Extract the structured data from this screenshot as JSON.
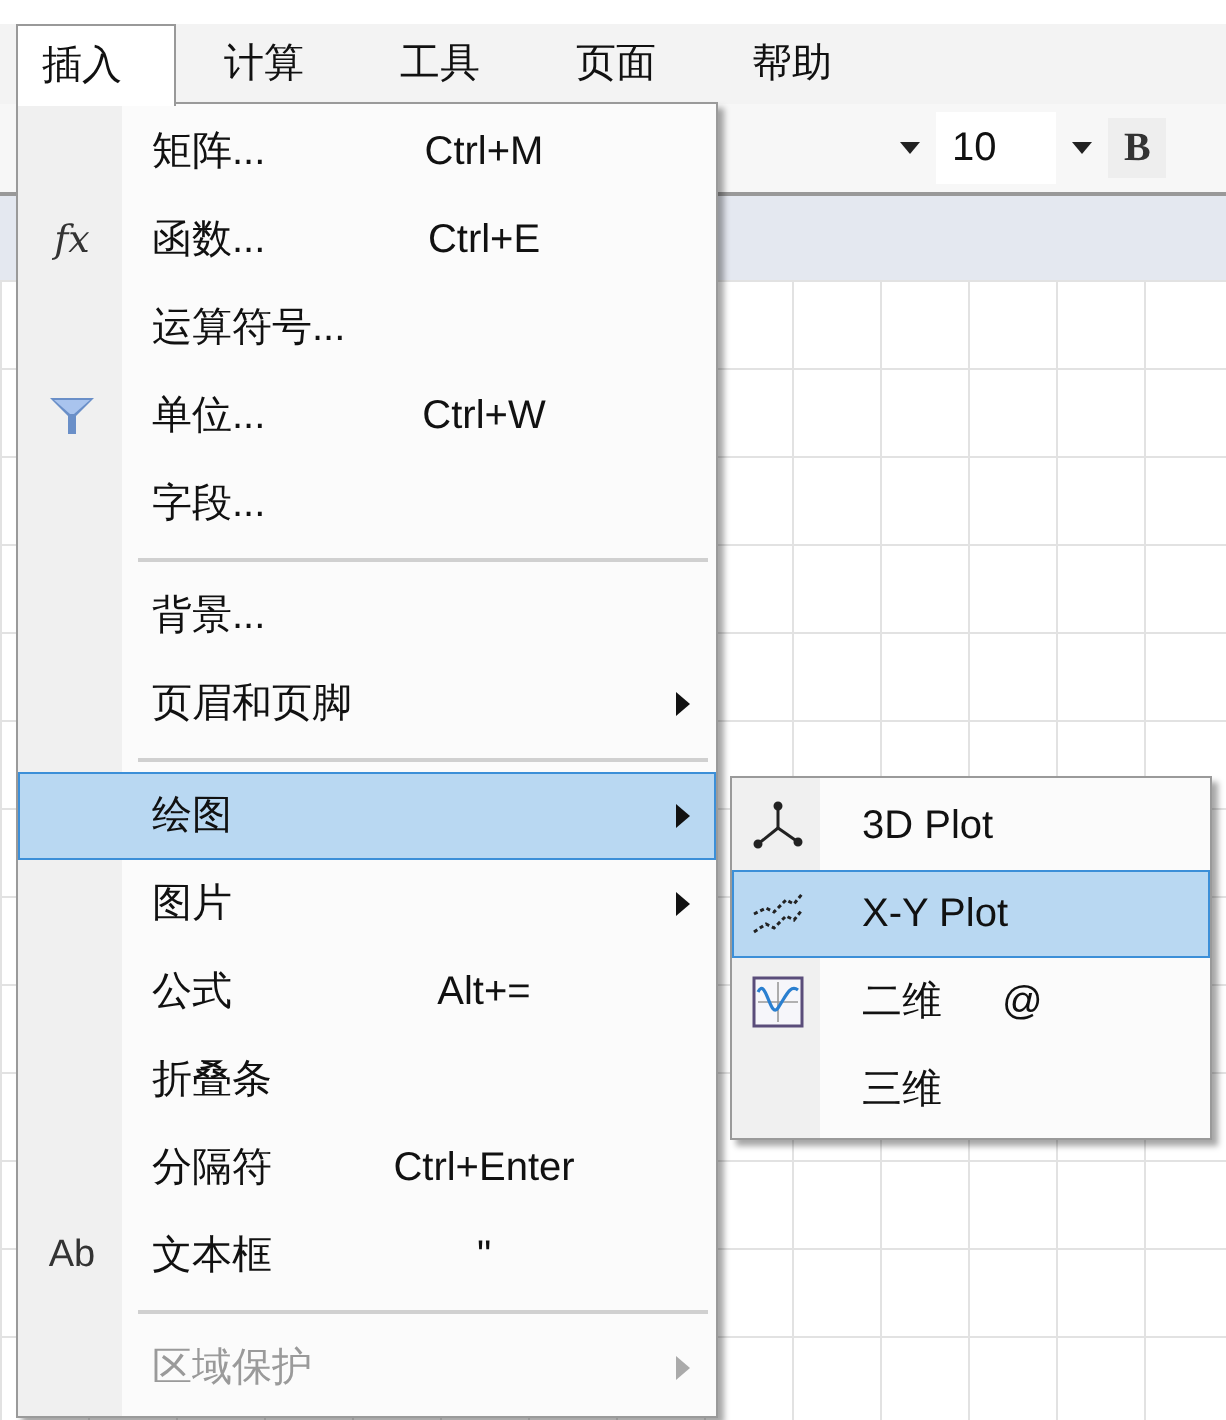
{
  "menubar": [
    {
      "label": "插入",
      "selected": true
    },
    {
      "label": "计算",
      "selected": false
    },
    {
      "label": "工具",
      "selected": false
    },
    {
      "label": "页面",
      "selected": false
    },
    {
      "label": "帮助",
      "selected": false
    }
  ],
  "toolbar": {
    "font_size": "10",
    "bold": "B"
  },
  "menu": {
    "items": [
      {
        "kind": "item",
        "label": "矩阵...",
        "shortcut": "Ctrl+M",
        "submenu": false,
        "disabled": false,
        "selected": false
      },
      {
        "kind": "item",
        "label": "函数...",
        "shortcut": "Ctrl+E",
        "submenu": false,
        "disabled": false,
        "selected": false,
        "icon_label": "fx"
      },
      {
        "kind": "item",
        "label": "运算符号...",
        "submenu": false,
        "disabled": false,
        "selected": false
      },
      {
        "kind": "item",
        "label": "单位...",
        "shortcut": "Ctrl+W",
        "submenu": false,
        "disabled": false,
        "selected": false
      },
      {
        "kind": "item",
        "label": "字段...",
        "submenu": false,
        "disabled": false,
        "selected": false
      },
      {
        "kind": "separator"
      },
      {
        "kind": "item",
        "label": "背景...",
        "submenu": false,
        "disabled": false,
        "selected": false
      },
      {
        "kind": "item",
        "label": "页眉和页脚",
        "submenu": true,
        "disabled": false,
        "selected": false
      },
      {
        "kind": "separator"
      },
      {
        "kind": "item",
        "label": "绘图",
        "submenu": true,
        "disabled": false,
        "selected": true
      },
      {
        "kind": "item",
        "label": "图片",
        "submenu": true,
        "disabled": false,
        "selected": false
      },
      {
        "kind": "item",
        "label": "公式",
        "shortcut": "Alt+=",
        "submenu": false,
        "disabled": false,
        "selected": false
      },
      {
        "kind": "item",
        "label": "折叠条",
        "submenu": false,
        "disabled": false,
        "selected": false
      },
      {
        "kind": "item",
        "label": "分隔符",
        "shortcut": "Ctrl+Enter",
        "submenu": false,
        "disabled": false,
        "selected": false
      },
      {
        "kind": "item",
        "label": "文本框",
        "shortcut": "\"",
        "submenu": false,
        "disabled": false,
        "selected": false,
        "icon_label": "Ab"
      },
      {
        "kind": "separator"
      },
      {
        "kind": "item",
        "label": "区域保护",
        "submenu": true,
        "disabled": true,
        "selected": false
      }
    ]
  },
  "submenu": {
    "items": [
      {
        "label": "3D Plot",
        "selected": false
      },
      {
        "label": "X-Y Plot",
        "selected": true
      },
      {
        "label": "二维",
        "shortcut": "@",
        "selected": false
      },
      {
        "label": "三维",
        "selected": false
      }
    ]
  }
}
